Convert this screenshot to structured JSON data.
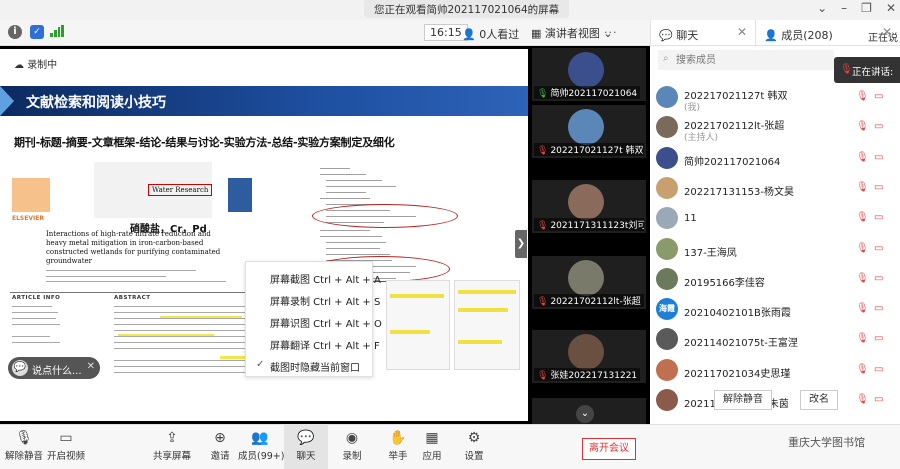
{
  "window": {
    "share_notice": "您正在观看简帅202117021064的屏幕",
    "controls": [
      "⌄",
      "–",
      "❐",
      "✕"
    ]
  },
  "toolbar": {
    "timer": "16:15",
    "viewers": "0人看过",
    "lecturer_view": "演讲者视图",
    "more": "···"
  },
  "tabs": {
    "chat": "聊天",
    "members": "成员(208)",
    "speaking_label": "正在说"
  },
  "shared_screen": {
    "recording": "录制中",
    "slide_title": "文献检索和阅读小技巧",
    "slide_subtitle": "期刊-标题-摘要-文章框架-结论-结果与讨论-实验方法-总结-实验方案制定及细化",
    "paper_journal": "Water Research",
    "paper_chem": "硝酸盐，Cr，Pd",
    "paper_title": "Interactions of high-rate nitrate reduction and heavy metal mitigation in iron-carbon-based constructed wetlands for purifying contaminated groundwater",
    "paper_logo": "ELSEVIER",
    "article_info": "ARTICLE INFO",
    "abstract": "ABSTRACT"
  },
  "screenshot_menu": {
    "items": [
      "屏幕截图 Ctrl + Alt + A",
      "屏幕录制 Ctrl + Alt + S",
      "屏幕识图 Ctrl + Alt + O",
      "屏幕翻译 Ctrl + Alt + F",
      "截图时隐藏当前窗口"
    ]
  },
  "chat_input": {
    "placeholder": "说点什么...",
    "close": "✕"
  },
  "videos": [
    {
      "name": "简帅202117021064",
      "mic": "on",
      "color": "#3b4f8c"
    },
    {
      "name": "202217021127t 韩双",
      "mic": "off",
      "color": "#5a86b8"
    },
    {
      "name": "2021171311123t刘可丽",
      "mic": "off",
      "color": "#8a6a5a"
    },
    {
      "name": "20221702112lt-张超",
      "mic": "off",
      "color": "#7a7a6a"
    },
    {
      "name": "张娃202217131221",
      "mic": "off",
      "color": "#6a5040"
    },
    {
      "name": "",
      "mic": "off",
      "color": "#444"
    }
  ],
  "members": {
    "search_placeholder": "搜索成员",
    "speaking_popup": "正在讲话:",
    "list": [
      {
        "name": "202217021127t 韩双",
        "sub": "(我)",
        "avatar_color": "#5a86b8",
        "initials": ""
      },
      {
        "name": "20221702112lt-张超",
        "sub": "(主持人)",
        "avatar_color": "#7a6a5a",
        "initials": ""
      },
      {
        "name": "简帅202117021064",
        "sub": "",
        "avatar_color": "#3b4f8c",
        "initials": ""
      },
      {
        "name": "202217131153-杨文昊",
        "sub": "",
        "avatar_color": "#c8a070",
        "initials": ""
      },
      {
        "name": "11",
        "sub": "",
        "avatar_color": "#9aa8b8",
        "initials": ""
      },
      {
        "name": "137-王海凤",
        "sub": "",
        "avatar_color": "#8a9a6a",
        "initials": ""
      },
      {
        "name": "20195166李佳容",
        "sub": "",
        "avatar_color": "#6a7a5a",
        "initials": ""
      },
      {
        "name": "20210402101B张雨霞",
        "sub": "",
        "avatar_color": "#1e7fd6",
        "initials": "海霞"
      },
      {
        "name": "202114021075t-王富涅",
        "sub": "",
        "avatar_color": "#5a5a5a",
        "initials": ""
      },
      {
        "name": "202117021034史思瑾",
        "sub": "",
        "avatar_color": "#c07050",
        "initials": ""
      },
      {
        "name": "202117021049+朱茵",
        "sub": "",
        "avatar_color": "#8a5a4a",
        "initials": ""
      }
    ],
    "unmute_all": "解除静音",
    "rename": "改名"
  },
  "bottombar": {
    "items": [
      {
        "label": "解除静音",
        "icon": "mic-off-icon",
        "glyph": "🎙"
      },
      {
        "label": "开启视频",
        "icon": "camera-off-icon",
        "glyph": "▭"
      },
      {
        "label": "共享屏幕",
        "icon": "share-screen-icon",
        "glyph": "⇪"
      },
      {
        "label": "邀请",
        "icon": "invite-icon",
        "glyph": "⊕"
      },
      {
        "label": "成员(99+)",
        "icon": "members-icon",
        "glyph": "👥"
      },
      {
        "label": "聊天",
        "icon": "chat-icon",
        "glyph": "💬"
      },
      {
        "label": "录制",
        "icon": "record-icon",
        "glyph": "◉"
      },
      {
        "label": "举手",
        "icon": "raise-hand-icon",
        "glyph": "✋"
      },
      {
        "label": "应用",
        "icon": "apps-icon",
        "glyph": "▦"
      },
      {
        "label": "设置",
        "icon": "settings-icon",
        "glyph": "⚙"
      }
    ],
    "leave": "离开会议",
    "watermark": "重庆大学图书馆"
  },
  "colors": {
    "accent_red": "#e64545",
    "slide_banner": "#1e4fa0",
    "mic_on": "#3cb44b"
  }
}
